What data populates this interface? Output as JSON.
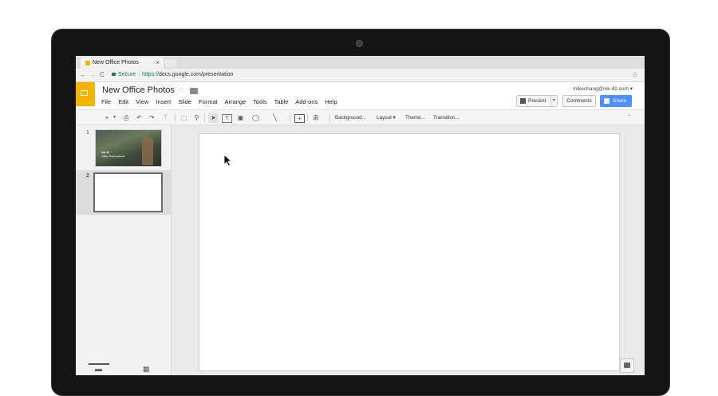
{
  "browser": {
    "tab_title": "New Office Photos",
    "tab_close": "×",
    "secure_label": "Secure",
    "url_scheme": "https://",
    "url_rest": "docs.google.com/presentation",
    "back": "←",
    "forward": "→",
    "reload": "C",
    "bookmark": "☆"
  },
  "docs": {
    "title": "New Office Photos",
    "title_star": "☆",
    "account": "mikechang@ink-42.com ▾",
    "menu": [
      "File",
      "Edit",
      "View",
      "Insert",
      "Slide",
      "Format",
      "Arrange",
      "Tools",
      "Table",
      "Add-ons",
      "Help"
    ],
    "present_label": "Present",
    "present_dropdown": "▾",
    "comments_label": "Comments",
    "share_label": "Share"
  },
  "toolbar": {
    "new_slide": "+",
    "new_slide_dd": "▾",
    "print": "⎙",
    "undo": "↶",
    "redo": "↷",
    "paint": "⍑",
    "zoom_fit": "▢",
    "zoom": "⚲",
    "select": "➤",
    "textbox": "T",
    "image": "▣",
    "shape": "◯",
    "line": "╲",
    "comment": "+",
    "input_tools": "あ",
    "background": "Background...",
    "layout": "Layout ▾",
    "theme": "Theme...",
    "transition": "Transition...",
    "collapse": "ˆ"
  },
  "filmstrip": {
    "slides": [
      {
        "number": "1",
        "title": "Ink-42",
        "subtitle": "Office Renovations"
      },
      {
        "number": "2"
      }
    ],
    "view_list": "▬",
    "view_grid": "▦"
  },
  "colors": {
    "logo": "#f4b400",
    "share": "#4d90fe",
    "secure": "#0b8043"
  }
}
